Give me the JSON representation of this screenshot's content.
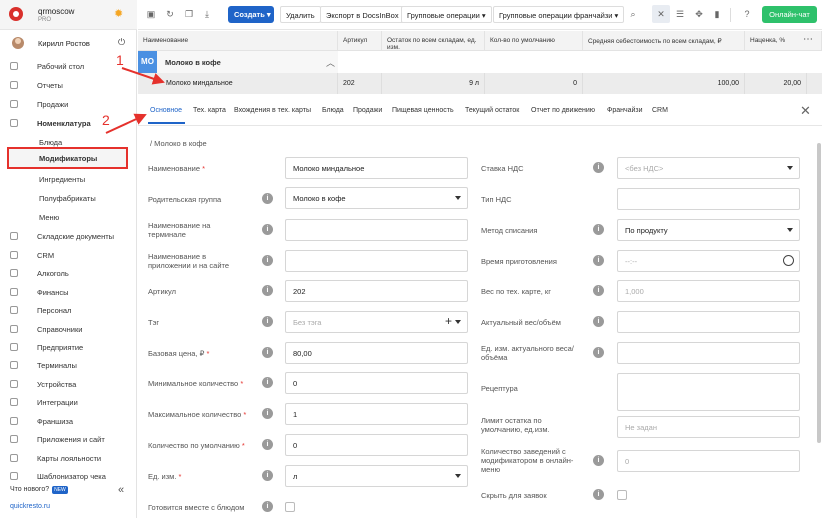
{
  "brand": {
    "name": "qrmoscow",
    "plan": "PRO"
  },
  "user": {
    "name": "Кирилл Ростов"
  },
  "sidebar": {
    "items": [
      {
        "label": "Рабочий стол"
      },
      {
        "label": "Отчеты"
      },
      {
        "label": "Продажи"
      },
      {
        "label": "Номенклатура"
      },
      {
        "label": "Блюда"
      },
      {
        "label": "Модификаторы"
      },
      {
        "label": "Ингредиенты"
      },
      {
        "label": "Полуфабрикаты"
      },
      {
        "label": "Меню"
      },
      {
        "label": "Складские документы"
      },
      {
        "label": "CRM"
      },
      {
        "label": "Алкоголь"
      },
      {
        "label": "Финансы"
      },
      {
        "label": "Персонал"
      },
      {
        "label": "Справочники"
      },
      {
        "label": "Предприятие"
      },
      {
        "label": "Терминалы"
      },
      {
        "label": "Устройства"
      },
      {
        "label": "Интеграции"
      },
      {
        "label": "Франшиза"
      },
      {
        "label": "Приложения и сайт"
      },
      {
        "label": "Карты лояльности"
      },
      {
        "label": "Шаблонизатор чека"
      }
    ],
    "whats_new": "Что нового?",
    "new_badge": "NEW",
    "site": "quickresto.ru"
  },
  "toolbar": {
    "create": "Создать",
    "delete": "Удалить",
    "export": "Экспорт в DocsInBox",
    "group_ops": "Групповые операции",
    "franchise_ops": "Групповые операции франчайзи",
    "chat": "Онлайн-чат"
  },
  "grid": {
    "headers": [
      "Наименование",
      "Артикул",
      "Остаток по всем складам, ед. изм.",
      "Кол-во по умолчанию",
      "Средняя себестоимость по всем складам, ₽",
      "Наценка, %"
    ],
    "group": {
      "badge": "МО",
      "name": "Молоко в кофе"
    },
    "row": {
      "name": "Молоко миндальное",
      "article": "202",
      "stock": "9 л",
      "default_qty": "0",
      "avg_cost": "100,00",
      "markup": "20,00"
    }
  },
  "tabs": [
    "Основное",
    "Тех. карта",
    "Вхождения в тех. карты",
    "Блюда",
    "Продажи",
    "Пищевая ценность",
    "Текущий остаток",
    "Отчет по движению",
    "Франчайзи",
    "CRM"
  ],
  "annotations": {
    "arrow1": "1",
    "arrow2": "2"
  },
  "form": {
    "breadcrumb": "/ Молоко в кофе",
    "left": {
      "name_label": "Наименование",
      "name_value": "Молоко миндальное",
      "parent_label": "Родительская группа",
      "parent_value": "Молоко в кофе",
      "terminal_name_label": "Наименование на терминале",
      "app_name_label": "Наименование в приложении и на сайте",
      "article_label": "Артикул",
      "article_value": "202",
      "tag_label": "Тэг",
      "tag_placeholder": "Без тэга",
      "base_price_label": "Базовая цена, ₽",
      "base_price_value": "80,00",
      "min_qty_label": "Минимальное количество",
      "min_qty_value": "0",
      "max_qty_label": "Максимальное количество",
      "max_qty_value": "1",
      "default_qty_label": "Количество по умолчанию",
      "default_qty_value": "0",
      "unit_label": "Ед. изм.",
      "unit_value": "л",
      "cook_together_label": "Готовится вместе с блюдом"
    },
    "right": {
      "vat_rate_label": "Ставка НДС",
      "vat_rate_value": "<без НДС>",
      "vat_type_label": "Тип НДС",
      "writeoff_label": "Метод списания",
      "writeoff_value": "По продукту",
      "cook_time_label": "Время приготовления",
      "cook_time_placeholder": "--:--",
      "weight_label": "Вес по тех. карте, кг",
      "weight_placeholder": "1,000",
      "actual_weight_label": "Актуальный вес/объём",
      "actual_unit_label": "Ед. изм. актуального веса/объёма",
      "recipe_label": "Рецептура",
      "stock_limit_label": "Лимит остатка по умолчанию, ед.изм.",
      "stock_limit_placeholder": "Не задан",
      "online_venues_label": "Количество заведений с модификатором в онлайн-меню",
      "online_venues_placeholder": "0",
      "hide_label": "Скрыть для заявок"
    }
  }
}
